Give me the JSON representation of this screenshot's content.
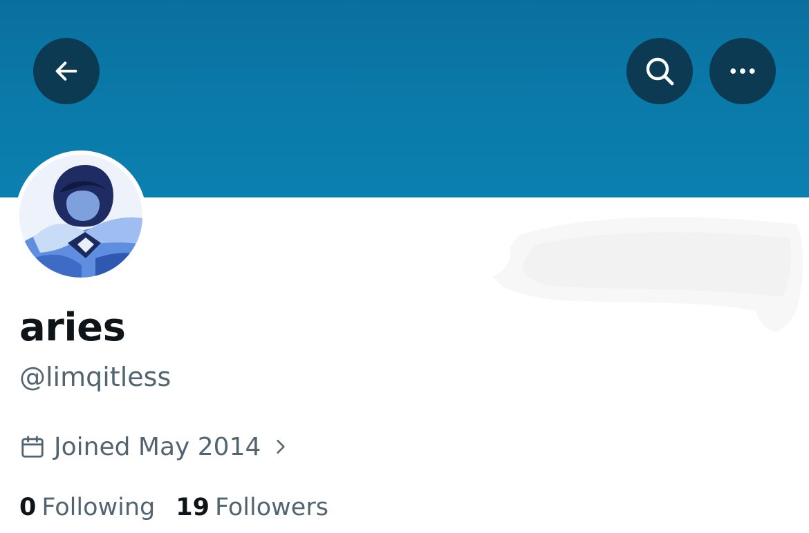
{
  "profile": {
    "display_name": "aries",
    "handle": "@limqitless",
    "joined_text": "Joined May 2014"
  },
  "stats": {
    "following_count": "0",
    "following_label": "Following",
    "followers_count": "19",
    "followers_label": "Followers"
  },
  "icons": {
    "back": "arrow-left-icon",
    "search": "search-icon",
    "more": "more-horizontal-icon",
    "calendar": "calendar-icon",
    "chevron": "chevron-right-icon"
  },
  "colors": {
    "banner": "#0a79a8",
    "header_button": "#0b3a52",
    "primary_text": "#0f1419",
    "secondary_text": "#536471"
  }
}
